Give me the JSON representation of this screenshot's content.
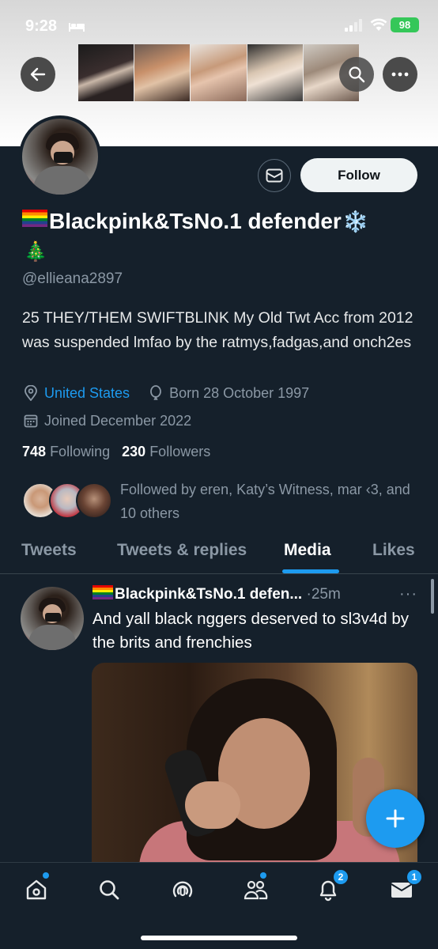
{
  "status_bar": {
    "time": "9:28",
    "battery": "98"
  },
  "header": {
    "back_icon": "arrow-left-icon",
    "search_icon": "search-icon",
    "more_icon": "more-horizontal-icon"
  },
  "profile": {
    "name": "Blackpink&TsNo.1 defender",
    "name_prefix_emoji": "rainbow-flag",
    "name_suffix_emoji": "❄️",
    "name_line2_emoji": "🎄",
    "handle": "@ellieana2897",
    "bio": "25 THEY/THEM SWIFTBLINK My Old Twt Acc from 2012 was suspended lmfao by the ratmys,fadgas,and onch2es",
    "location": "United States",
    "birth": "Born 28 October 1997",
    "joined": "Joined December 2022",
    "following_count": "748",
    "following_label": "Following",
    "followers_count": "230",
    "followers_label": "Followers",
    "followed_by": "Followed by eren, Katy’s Witness, mar ‹3, and 10 others",
    "follow_label": "Follow"
  },
  "tabs": [
    {
      "label": "Tweets"
    },
    {
      "label": "Tweets & replies"
    },
    {
      "label": "Media"
    },
    {
      "label": "Likes"
    }
  ],
  "active_tab": "Media",
  "tweet": {
    "name": "Blackpink&TsNo.1 defen...",
    "separator": "·",
    "time": "25m",
    "more": "···",
    "text": "And yall black nggers deserved to sl3v4d by the brits and frenchies"
  },
  "bottom_nav": {
    "notifications_badge": "2",
    "messages_badge": "1"
  },
  "colors": {
    "background": "#15202b",
    "accent": "#1d9bf0",
    "muted": "#8b98a5"
  }
}
